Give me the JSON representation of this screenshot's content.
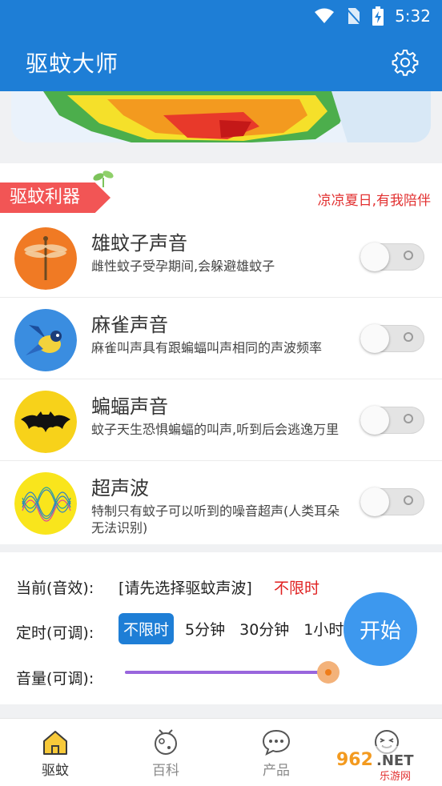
{
  "status_bar": {
    "time": "5:32"
  },
  "app_bar": {
    "title": "驱蚊大师"
  },
  "section": {
    "tag": "驱蚊利器",
    "slogan": "凉凉夏日,有我陪伴"
  },
  "sounds": [
    {
      "name": "雄蚊子声音",
      "desc": "雌性蚊子受孕期间,会躲避雄蚊子",
      "enabled": false
    },
    {
      "name": "麻雀声音",
      "desc": "麻雀叫声具有跟蝙蝠叫声相同的声波频率",
      "enabled": false
    },
    {
      "name": "蝙蝠声音",
      "desc": "蚊子天生恐惧蝙蝠的叫声,听到后会逃逸万里",
      "enabled": false
    },
    {
      "name": "超声波",
      "desc": "特制只有蚊子可以听到的噪音超声(人类耳朵无法识别)",
      "enabled": false
    }
  ],
  "controls": {
    "current_label": "当前(音效):",
    "current_value": "[请先选择驱蚊声波]",
    "current_mode": "不限时",
    "timer_label": "定时(可调):",
    "timer_options": [
      "不限时",
      "5分钟",
      "30分钟",
      "1小时"
    ],
    "timer_selected": 0,
    "volume_label": "音量(可调):",
    "volume": 1.0,
    "start_label": "开始"
  },
  "bottom_nav": [
    {
      "label": "驱蚊",
      "icon": "home-icon",
      "active": true
    },
    {
      "label": "百科",
      "icon": "encyclopedia-icon",
      "active": false
    },
    {
      "label": "产品",
      "icon": "chat-icon",
      "active": false
    },
    {
      "label": "",
      "icon": "face-icon",
      "active": false
    }
  ],
  "watermark": "962.NET 乐游网",
  "colors": {
    "primary": "#1e7ed6",
    "tag": "#f25555",
    "accent_red": "#e02020",
    "slider": "#9966dd",
    "start_button": "#3d98ee"
  }
}
